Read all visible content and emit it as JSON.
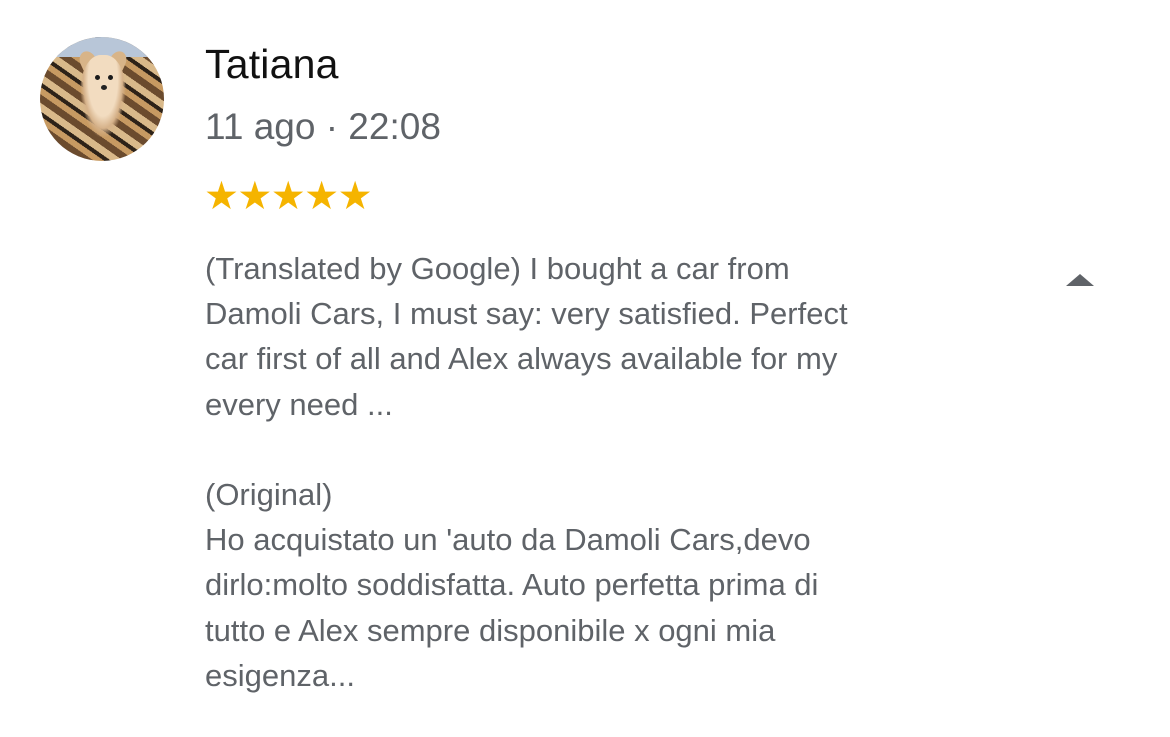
{
  "review": {
    "author": "Tatiana",
    "date": "11 ago · 22:08",
    "rating": 5,
    "stars": [
      "★",
      "★",
      "★",
      "★",
      "★"
    ],
    "star_color": "#f5b400",
    "translated": {
      "lines": [
        "(Translated by Google) I bought a car from",
        "Damoli Cars, I must say: very satisfied. Perfect",
        "car first of all and Alex always available for my",
        "every need ..."
      ]
    },
    "original": {
      "heading": "(Original)",
      "lines": [
        "Ho acquistato un 'auto da Damoli Cars,devo",
        "dirlo:molto soddisfatta. Auto perfetta prima di",
        "tutto e Alex sempre disponibile x ogni mia",
        "esigenza..."
      ]
    },
    "collapse_icon": "chevron-up-icon",
    "avatar_icon": "profile-photo-dog"
  }
}
